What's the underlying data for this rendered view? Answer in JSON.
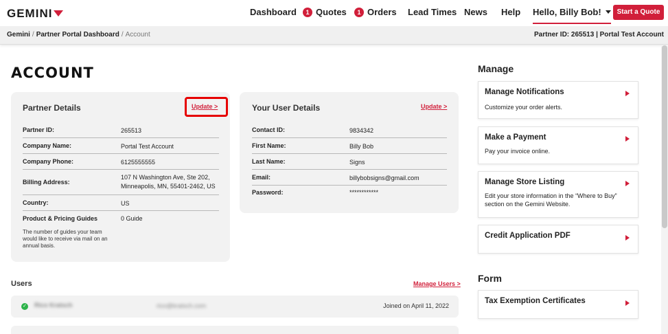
{
  "nav": {
    "logo": "GEMINI",
    "items": [
      {
        "label": "Dashboard"
      },
      {
        "label": "Quotes",
        "badge": "1"
      },
      {
        "label": "Orders",
        "badge": "1"
      },
      {
        "label": "Lead Times"
      },
      {
        "label": "News"
      },
      {
        "label": "Help"
      }
    ],
    "user_greeting": "Hello, Billy Bob!",
    "cta": "Start a Quote"
  },
  "breadcrumb": {
    "items": [
      "Gemini",
      "Partner Portal Dashboard"
    ],
    "current": "Account",
    "separator": "/",
    "partner_info": "Partner ID: 265513 | Portal Test Account"
  },
  "page": {
    "title": "ACCOUNT"
  },
  "partner_details": {
    "heading": "Partner Details",
    "update": "Update >",
    "rows": [
      {
        "label": "Partner ID:",
        "value": "265513"
      },
      {
        "label": "Company Name:",
        "value": "Portal Test Account"
      },
      {
        "label": "Company Phone:",
        "value": "6125555555"
      },
      {
        "label": "Billing Address:",
        "value": "107 N Washington Ave, Ste 202,",
        "value2": "Minneapolis, MN, 55401-2462, US"
      },
      {
        "label": "Country:",
        "value": "US"
      },
      {
        "label": "Product & Pricing Guides",
        "value": "0 Guide"
      }
    ],
    "note": [
      "The number of guides your team",
      "would like to receive via mail on an",
      "annual basis."
    ]
  },
  "user_details": {
    "heading": "Your User Details",
    "update": "Update >",
    "rows": [
      {
        "label": "Contact ID:",
        "value": "9834342"
      },
      {
        "label": "First Name:",
        "value": "Billy Bob"
      },
      {
        "label": "Last Name:",
        "value": "Signs"
      },
      {
        "label": "Email:",
        "value": "billybobsigns@gmail.com"
      },
      {
        "label": "Password:",
        "value": "************"
      }
    ]
  },
  "users": {
    "heading": "Users",
    "manage": "Manage Users >",
    "rows": [
      {
        "name": "Rico Kratsch",
        "email": "rico@kratsch.com",
        "joined": "Joined on April 11, 2022"
      }
    ]
  },
  "manage": {
    "heading": "Manage",
    "cards": [
      {
        "title": "Manage Notifications",
        "desc": "Customize your order alerts."
      },
      {
        "title": "Make a Payment",
        "desc": "Pay your invoice online."
      },
      {
        "title": "Manage Store Listing",
        "desc": "Edit your store information in the “Where to Buy” section on the Gemini Website."
      },
      {
        "title": "Credit Application PDF",
        "desc": ""
      }
    ]
  },
  "form": {
    "heading": "Form",
    "cards": [
      {
        "title": "Tax Exemption Certificates"
      }
    ]
  },
  "colors": {
    "brand": "#d11f3a",
    "highlight": "#e60000",
    "success": "#2db34a"
  }
}
